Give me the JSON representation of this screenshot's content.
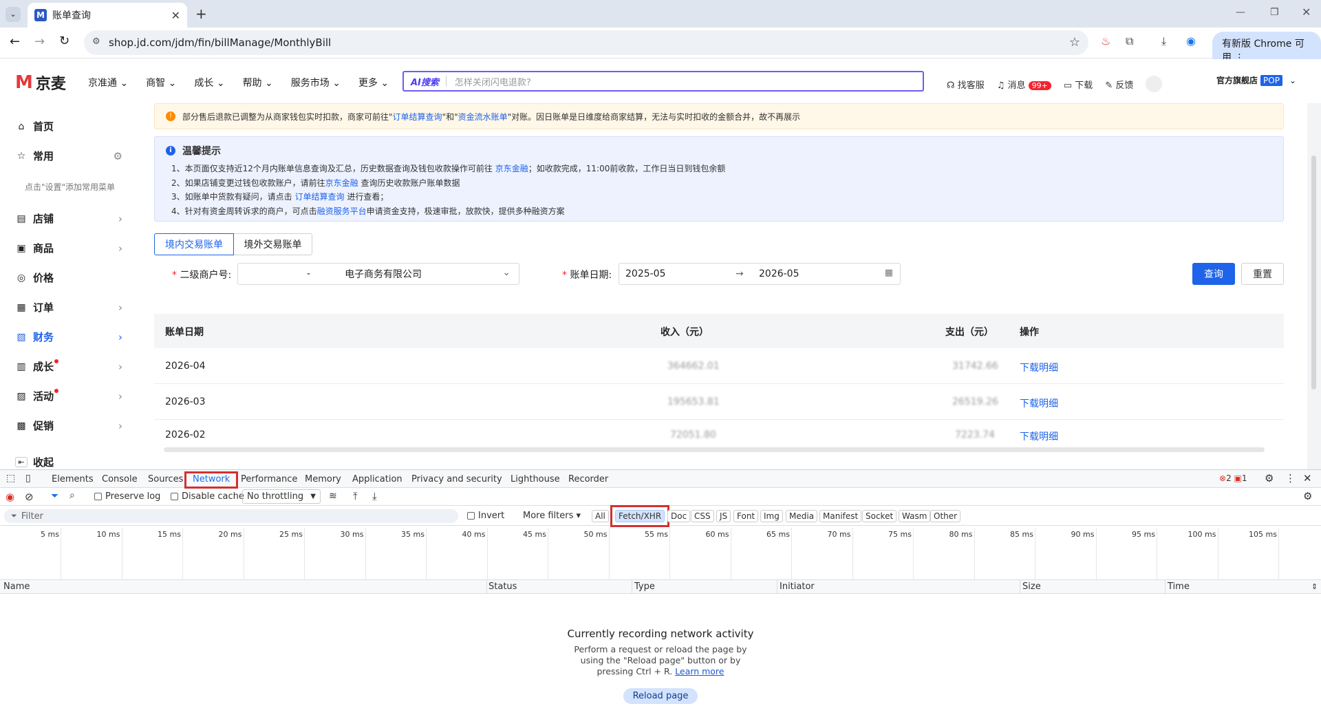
{
  "browser": {
    "tab_title": "账单查询",
    "url": "shop.jd.com/jdm/fin/billManage/MonthlyBill",
    "update_chip": "有新版 Chrome 可用"
  },
  "site": {
    "logo": "京麦",
    "nav": [
      "京准通",
      "商智",
      "成长",
      "帮助",
      "服务市场",
      "更多"
    ],
    "ai_label": "AI搜索",
    "search_placeholder": "怎样关闭闪电退款?",
    "right": {
      "service": "找客服",
      "messages": "消息",
      "msg_badge": "99+",
      "download": "下载",
      "feedback": "反馈",
      "store": "官方旗舰店",
      "store_badge": "POP"
    }
  },
  "sidebar": {
    "items": [
      {
        "label": "首页",
        "icon": "home-icon",
        "glyph": "⌂"
      },
      {
        "label": "常用",
        "icon": "star-icon",
        "glyph": "☆"
      }
    ],
    "hint": "点击\"设置\"添加常用菜单",
    "menu": [
      {
        "label": "店铺",
        "glyph": "▤"
      },
      {
        "label": "商品",
        "glyph": "▣"
      },
      {
        "label": "价格",
        "glyph": "◎"
      },
      {
        "label": "订单",
        "glyph": "▦"
      },
      {
        "label": "财务",
        "glyph": "▧"
      },
      {
        "label": "成长",
        "glyph": "▥"
      },
      {
        "label": "活动",
        "glyph": "▨"
      },
      {
        "label": "促销",
        "glyph": "▩"
      }
    ],
    "collapse": "收起"
  },
  "notice": {
    "warning_prefix": "部分售后退款已调整为从商家钱包实时扣款，商家可前往\"",
    "warning_link1": "订单结算查询",
    "warning_mid": "\"和\"",
    "warning_link2": "资金流水账单",
    "warning_suffix": "\"对账。因日账单是日维度给商家结算，无法与实时扣收的金额合并，故不再展示",
    "tip_title": "温馨提示",
    "tip1_a": "1、本页面仅支持近12个月内账单信息查询及汇总，历史数据查询及钱包收款操作可前往",
    "tip1_link": "京东金融",
    "tip1_b": "；如收款完成，11:00前收款，工作日当日到钱包余额",
    "tip2_a": "2、如果店铺变更过钱包收款账户，请前往",
    "tip2_link": "京东金融",
    "tip2_b": "查询历史收款账户账单数据",
    "tip3_a": "3、如账单中货款有疑问，请点击",
    "tip3_link": "订单结算查询",
    "tip3_b": "进行查看；",
    "tip4_a": "4、针对有资金周转诉求的商户，可点击",
    "tip4_link": "融资服务平台",
    "tip4_b": "申请资金支持，极速审批，放款快，提供多种融资方案"
  },
  "bill_tabs": [
    "境内交易账单",
    "境外交易账单"
  ],
  "filters": {
    "merchant_label": "二级商户号:",
    "merchant_dash": "-",
    "merchant_value": "电子商务有限公司",
    "date_label": "账单日期:",
    "date_from": "2025-05",
    "date_arrow": "→",
    "date_to": "2026-05",
    "query": "查询",
    "reset": "重置"
  },
  "table": {
    "headers": [
      "账单日期",
      "收入（元）",
      "支出（元）",
      "操作"
    ],
    "rows": [
      {
        "date": "2026-04",
        "income": "364662.01",
        "expense": "31742.66",
        "action": "下载明细"
      },
      {
        "date": "2026-03",
        "income": "195653.81",
        "expense": "26519.26",
        "action": "下载明细"
      },
      {
        "date": "2026-02",
        "income": "72051.80",
        "expense": "7223.74",
        "action": "下载明细"
      }
    ]
  },
  "devtools": {
    "tabs": [
      "Elements",
      "Console",
      "Sources",
      "Network",
      "Performance",
      "Memory",
      "Application",
      "Privacy and security",
      "Lighthouse",
      "Recorder"
    ],
    "errors": "2",
    "warnings": "1",
    "preserve_log": "Preserve log",
    "disable_cache": "Disable cache",
    "throttling": "No throttling",
    "filter_placeholder": "Filter",
    "invert": "Invert",
    "more_filters": "More filters",
    "types": [
      "All",
      "Fetch/XHR",
      "Doc",
      "CSS",
      "JS",
      "Font",
      "Img",
      "Media",
      "Manifest",
      "Socket",
      "Wasm",
      "Other"
    ],
    "ticks": [
      "5 ms",
      "10 ms",
      "15 ms",
      "20 ms",
      "25 ms",
      "30 ms",
      "35 ms",
      "40 ms",
      "45 ms",
      "50 ms",
      "55 ms",
      "60 ms",
      "65 ms",
      "70 ms",
      "75 ms",
      "80 ms",
      "85 ms",
      "90 ms",
      "95 ms",
      "100 ms",
      "105 ms"
    ],
    "columns": [
      "Name",
      "Status",
      "Type",
      "Initiator",
      "Size",
      "Time"
    ],
    "empty_title": "Currently recording network activity",
    "empty_line1": "Perform a request or reload the page by",
    "empty_line2": "using the \"Reload page\" button or by",
    "empty_line3": "pressing Ctrl + R.",
    "learn_more": "Learn more",
    "reload": "Reload page"
  }
}
